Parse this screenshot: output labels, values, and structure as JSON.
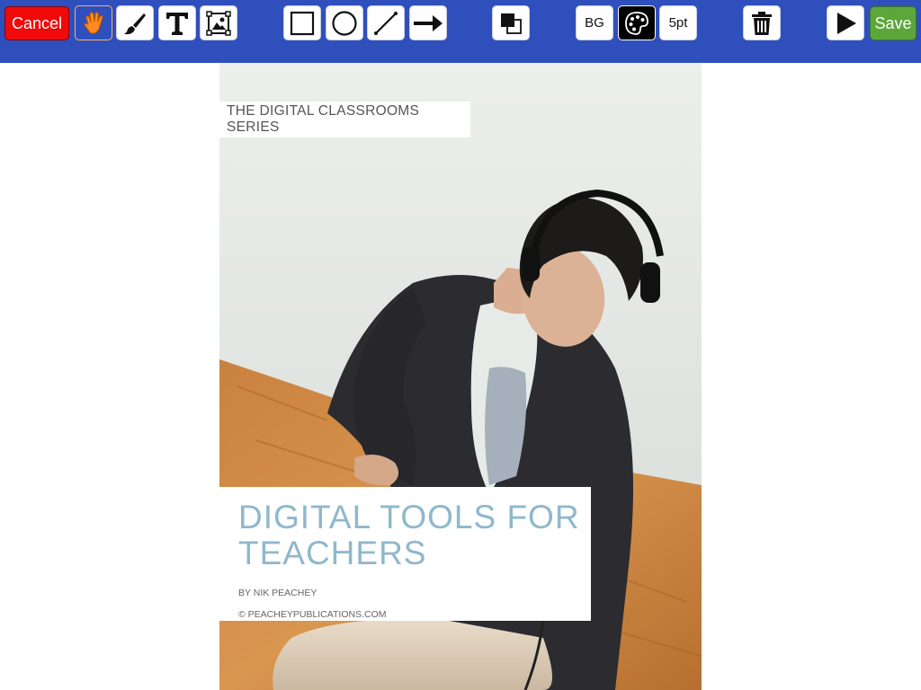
{
  "toolbar": {
    "cancel_label": "Cancel",
    "save_label": "Save",
    "bg_label": "BG",
    "stroke_size_label": "5pt",
    "tools": [
      {
        "name": "hand-tool",
        "icon": "hand-icon",
        "selected": true
      },
      {
        "name": "brush-tool",
        "icon": "brush-icon"
      },
      {
        "name": "text-tool",
        "icon": "text-icon"
      },
      {
        "name": "image-tool",
        "icon": "image-icon"
      },
      {
        "name": "rectangle-tool",
        "icon": "rectangle-icon"
      },
      {
        "name": "circle-tool",
        "icon": "circle-icon"
      },
      {
        "name": "line-tool",
        "icon": "line-icon"
      },
      {
        "name": "arrow-tool",
        "icon": "arrow-icon"
      },
      {
        "name": "layer-order",
        "icon": "layers-icon"
      },
      {
        "name": "color-palette",
        "icon": "palette-icon"
      },
      {
        "name": "delete",
        "icon": "trash-icon"
      },
      {
        "name": "play",
        "icon": "play-icon"
      }
    ],
    "colors": {
      "bar": "#2f4fbd",
      "cancel": "#f10a0a",
      "save": "#5da63a"
    }
  },
  "cover": {
    "series": "THE DIGITAL CLASSROOMS SERIES",
    "title_line1": "DIGITAL TOOLS FOR",
    "title_line2": "TEACHERS",
    "author": "BY NIK PEACHEY",
    "copyright": "© PEACHEYPUBLICATIONS.COM",
    "title_color": "#8fb8cd"
  }
}
